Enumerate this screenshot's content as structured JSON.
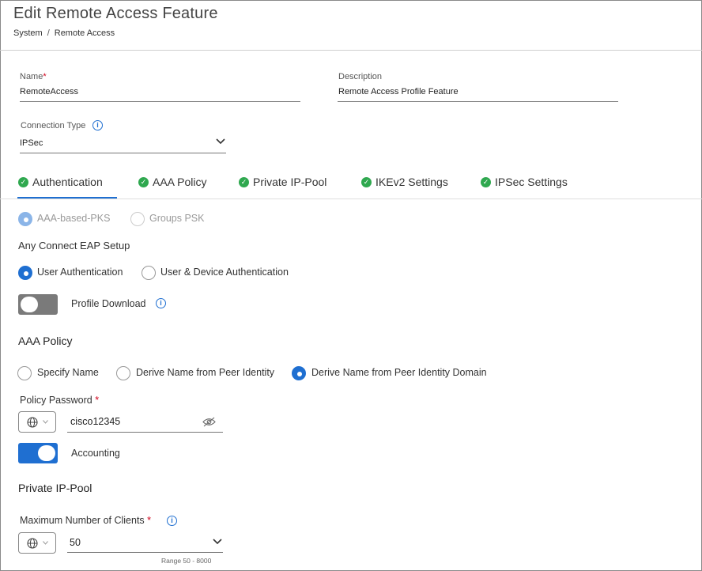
{
  "header": {
    "title": "Edit Remote Access Feature",
    "breadcrumb": [
      "System",
      "Remote Access"
    ],
    "breadcrumb_sep": "/"
  },
  "form": {
    "name": {
      "label": "Name",
      "required_mark": "*",
      "value": "RemoteAccess"
    },
    "description": {
      "label": "Description",
      "value": "Remote Access Profile Feature"
    },
    "connection_type": {
      "label": "Connection Type",
      "value": "IPSec"
    }
  },
  "tabs": [
    {
      "label": "Authentication",
      "active": true
    },
    {
      "label": "AAA Policy"
    },
    {
      "label": "Private IP-Pool"
    },
    {
      "label": "IKEv2 Settings"
    },
    {
      "label": "IPSec Settings"
    }
  ],
  "auth_mode": {
    "options": [
      "AAA-based-PKS",
      "Groups PSK"
    ],
    "selected": "AAA-based-PKS"
  },
  "eap": {
    "label": "Any Connect EAP Setup",
    "options": [
      "User Authentication",
      "User & Device Authentication"
    ],
    "selected": "User Authentication"
  },
  "profile_download": {
    "label": "Profile Download",
    "enabled": false
  },
  "aaa_policy": {
    "title": "AAA Policy",
    "options": [
      "Specify Name",
      "Derive Name from Peer Identity",
      "Derive Name from Peer Identity Domain"
    ],
    "selected": "Derive Name from Peer Identity Domain",
    "password_label": "Policy Password",
    "password_required": "*",
    "password_value": "cisco12345"
  },
  "accounting": {
    "label": "Accounting",
    "enabled": true
  },
  "private_pool": {
    "title": "Private IP-Pool",
    "max_clients_label": "Maximum Number of Clients",
    "max_clients_required": "*",
    "max_clients_value": "50",
    "range_hint": "Range 50 - 8000"
  },
  "colors": {
    "accent": "#1f6fd1",
    "success": "#2fa84f",
    "required": "#d0021b"
  }
}
